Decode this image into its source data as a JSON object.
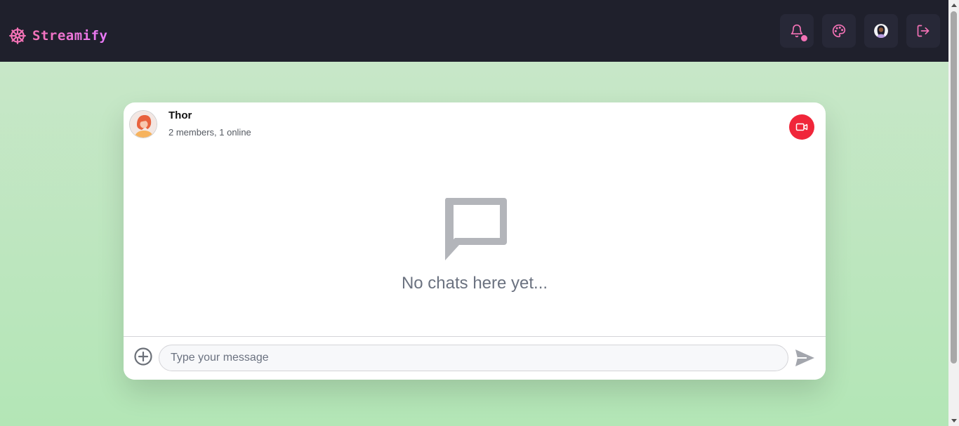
{
  "navbar": {
    "brand_name": "Streamify",
    "icons": {
      "brand": "ship-wheel-icon",
      "notifications": "bell-icon",
      "theme": "palette-icon",
      "profile": "user-avatar",
      "logout": "logout-icon"
    },
    "has_unread_notifications": true
  },
  "chat": {
    "channel_name": "Thor",
    "member_summary": "2 members, 1 online",
    "empty_message": "No chats here yet...",
    "input_placeholder": "Type your message",
    "input_value": "",
    "icons": {
      "video_call": "video-camera-icon",
      "empty_state": "chat-bubble-icon",
      "attach": "plus-circle-icon",
      "send": "send-icon"
    }
  },
  "colors": {
    "navbar_bg": "#1f202c",
    "brand_accent": "#f472b6",
    "video_call_button": "#f0263a",
    "page_bg": "#b3e6b6"
  }
}
